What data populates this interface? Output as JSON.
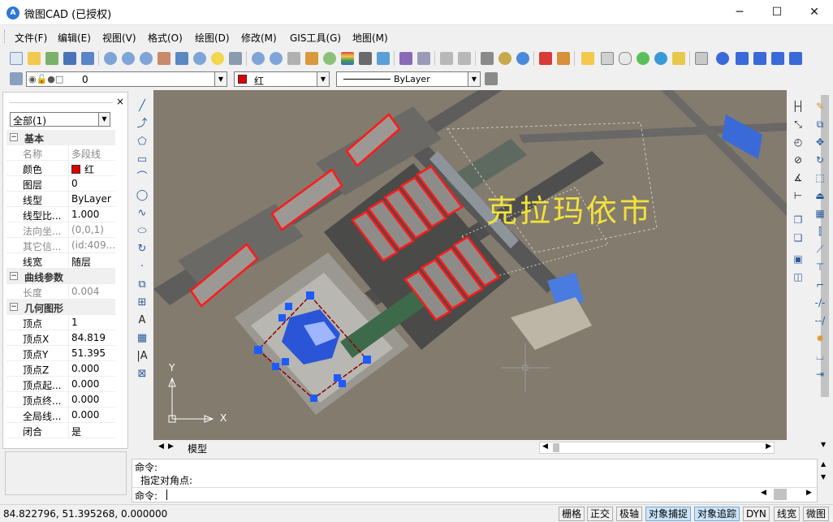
{
  "window": {
    "title": "微图CAD (已授权)",
    "app_icon": "A",
    "minimize": "─",
    "maximize": "☐",
    "close": "✕"
  },
  "menu": [
    "文件(F)",
    "编辑(E)",
    "视图(V)",
    "格式(O)",
    "绘图(D)",
    "修改(M)",
    "GIS工具(G)",
    "地图(M)"
  ],
  "layer_bar": {
    "layer_value": "0",
    "color_value": "红",
    "linetype_value": "ByLayer"
  },
  "properties": {
    "close": "×",
    "selection": "全部(1)",
    "rows": [
      {
        "type": "cat",
        "key": "基本",
        "toggle": "−"
      },
      {
        "key": "名称",
        "value": "多段线",
        "gray": true
      },
      {
        "key": "颜色",
        "value": "红",
        "swatch": "#e00000"
      },
      {
        "key": "图层",
        "value": "0"
      },
      {
        "key": "线型",
        "value": "ByLayer"
      },
      {
        "key": "线型比...",
        "value": "1.000"
      },
      {
        "key": "法向坐...",
        "value": "(0,0,1)",
        "gray": true
      },
      {
        "key": "其它信...",
        "value": "(id:409...",
        "gray": true
      },
      {
        "key": "线宽",
        "value": "随层"
      },
      {
        "type": "cat",
        "key": "曲线参数",
        "toggle": "−"
      },
      {
        "key": "长度",
        "value": "0.004",
        "gray": true
      },
      {
        "type": "cat",
        "key": "几何图形",
        "toggle": "−"
      },
      {
        "key": "顶点",
        "value": "1"
      },
      {
        "key": "顶点X",
        "value": "84.819"
      },
      {
        "key": "顶点Y",
        "value": "51.395"
      },
      {
        "key": "顶点Z",
        "value": "0.000"
      },
      {
        "key": "顶点起...",
        "value": "0.000"
      },
      {
        "key": "顶点终...",
        "value": "0.000"
      },
      {
        "key": "全局线...",
        "value": "0.000"
      },
      {
        "key": "闭合",
        "value": "是"
      }
    ]
  },
  "canvas": {
    "city_label": "克拉玛依市",
    "ucs_y": "Y",
    "ucs_x": "X",
    "accent_red": "#ff1a1a",
    "grip_blue": "#1e5bff"
  },
  "tabs": {
    "model": "模型",
    "nav_first": "◀",
    "nav_next": "▶"
  },
  "command": {
    "lines": [
      "命令:",
      "指定对角点:"
    ],
    "prompt": "命令:"
  },
  "status": {
    "coords": "84.822796,  51.395268,  0.000000",
    "buttons": [
      {
        "label": "栅格",
        "on": false
      },
      {
        "label": "正交",
        "on": false
      },
      {
        "label": "极轴",
        "on": false
      },
      {
        "label": "对象捕捉",
        "on": true
      },
      {
        "label": "对象追踪",
        "on": true
      },
      {
        "label": "DYN",
        "on": false
      },
      {
        "label": "线宽",
        "on": false
      },
      {
        "label": "微图",
        "on": false
      }
    ]
  }
}
